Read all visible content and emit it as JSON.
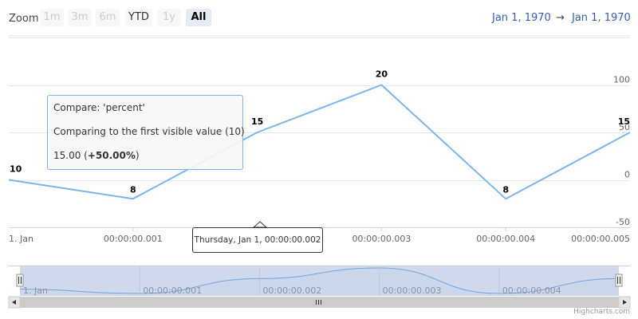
{
  "range_selector": {
    "zoom_label": "Zoom",
    "buttons": [
      {
        "label": "1m",
        "state": "disabled"
      },
      {
        "label": "3m",
        "state": "disabled"
      },
      {
        "label": "6m",
        "state": "disabled"
      },
      {
        "label": "YTD",
        "state": "enabled"
      },
      {
        "label": "1y",
        "state": "disabled"
      },
      {
        "label": "All",
        "state": "active"
      }
    ],
    "from": "Jan 1, 1970",
    "arrow": "→",
    "to": "Jan 1, 1970"
  },
  "tooltip": {
    "line1": "Compare: 'percent'",
    "line2": "Comparing to the first visible value (10)",
    "line3_value": "15.00 (",
    "line3_bold": "+50.00%",
    "line3_end": ")"
  },
  "crosshair_label": "Thursday, Jan 1, 00:00:00.002",
  "credits": "Highcharts.com",
  "colors": {
    "series": "#7cb5ec",
    "navigator_mask": "rgba(102,133,194,0.3)",
    "grid": "#e6e6e6"
  },
  "chart_data": {
    "type": "line",
    "x": [
      0,
      1,
      2,
      3,
      4,
      5
    ],
    "x_tick_labels": [
      "1. Jan",
      "00:00:00.001",
      "00:00:00.002",
      "00:00:00.003",
      "00:00:00.004",
      "00:00:00.005"
    ],
    "series": [
      {
        "values": [
          10,
          8,
          15,
          20,
          8,
          15
        ]
      }
    ],
    "data_labels": [
      "10",
      "8",
      "15",
      "20",
      "8",
      "15"
    ],
    "compare": "percent",
    "percent_values": [
      0,
      -20,
      50,
      100,
      -20,
      50
    ],
    "y_ticks": [
      -50,
      0,
      50,
      100
    ],
    "ylim": [
      -50,
      150
    ],
    "navigator_x_labels": [
      "1. Jan",
      "00:00:00.001",
      "00:00:00.002",
      "00:00:00.003",
      "00:00:00.004"
    ],
    "navigator_selection": [
      0,
      5
    ],
    "grid": true,
    "legend": "none"
  }
}
